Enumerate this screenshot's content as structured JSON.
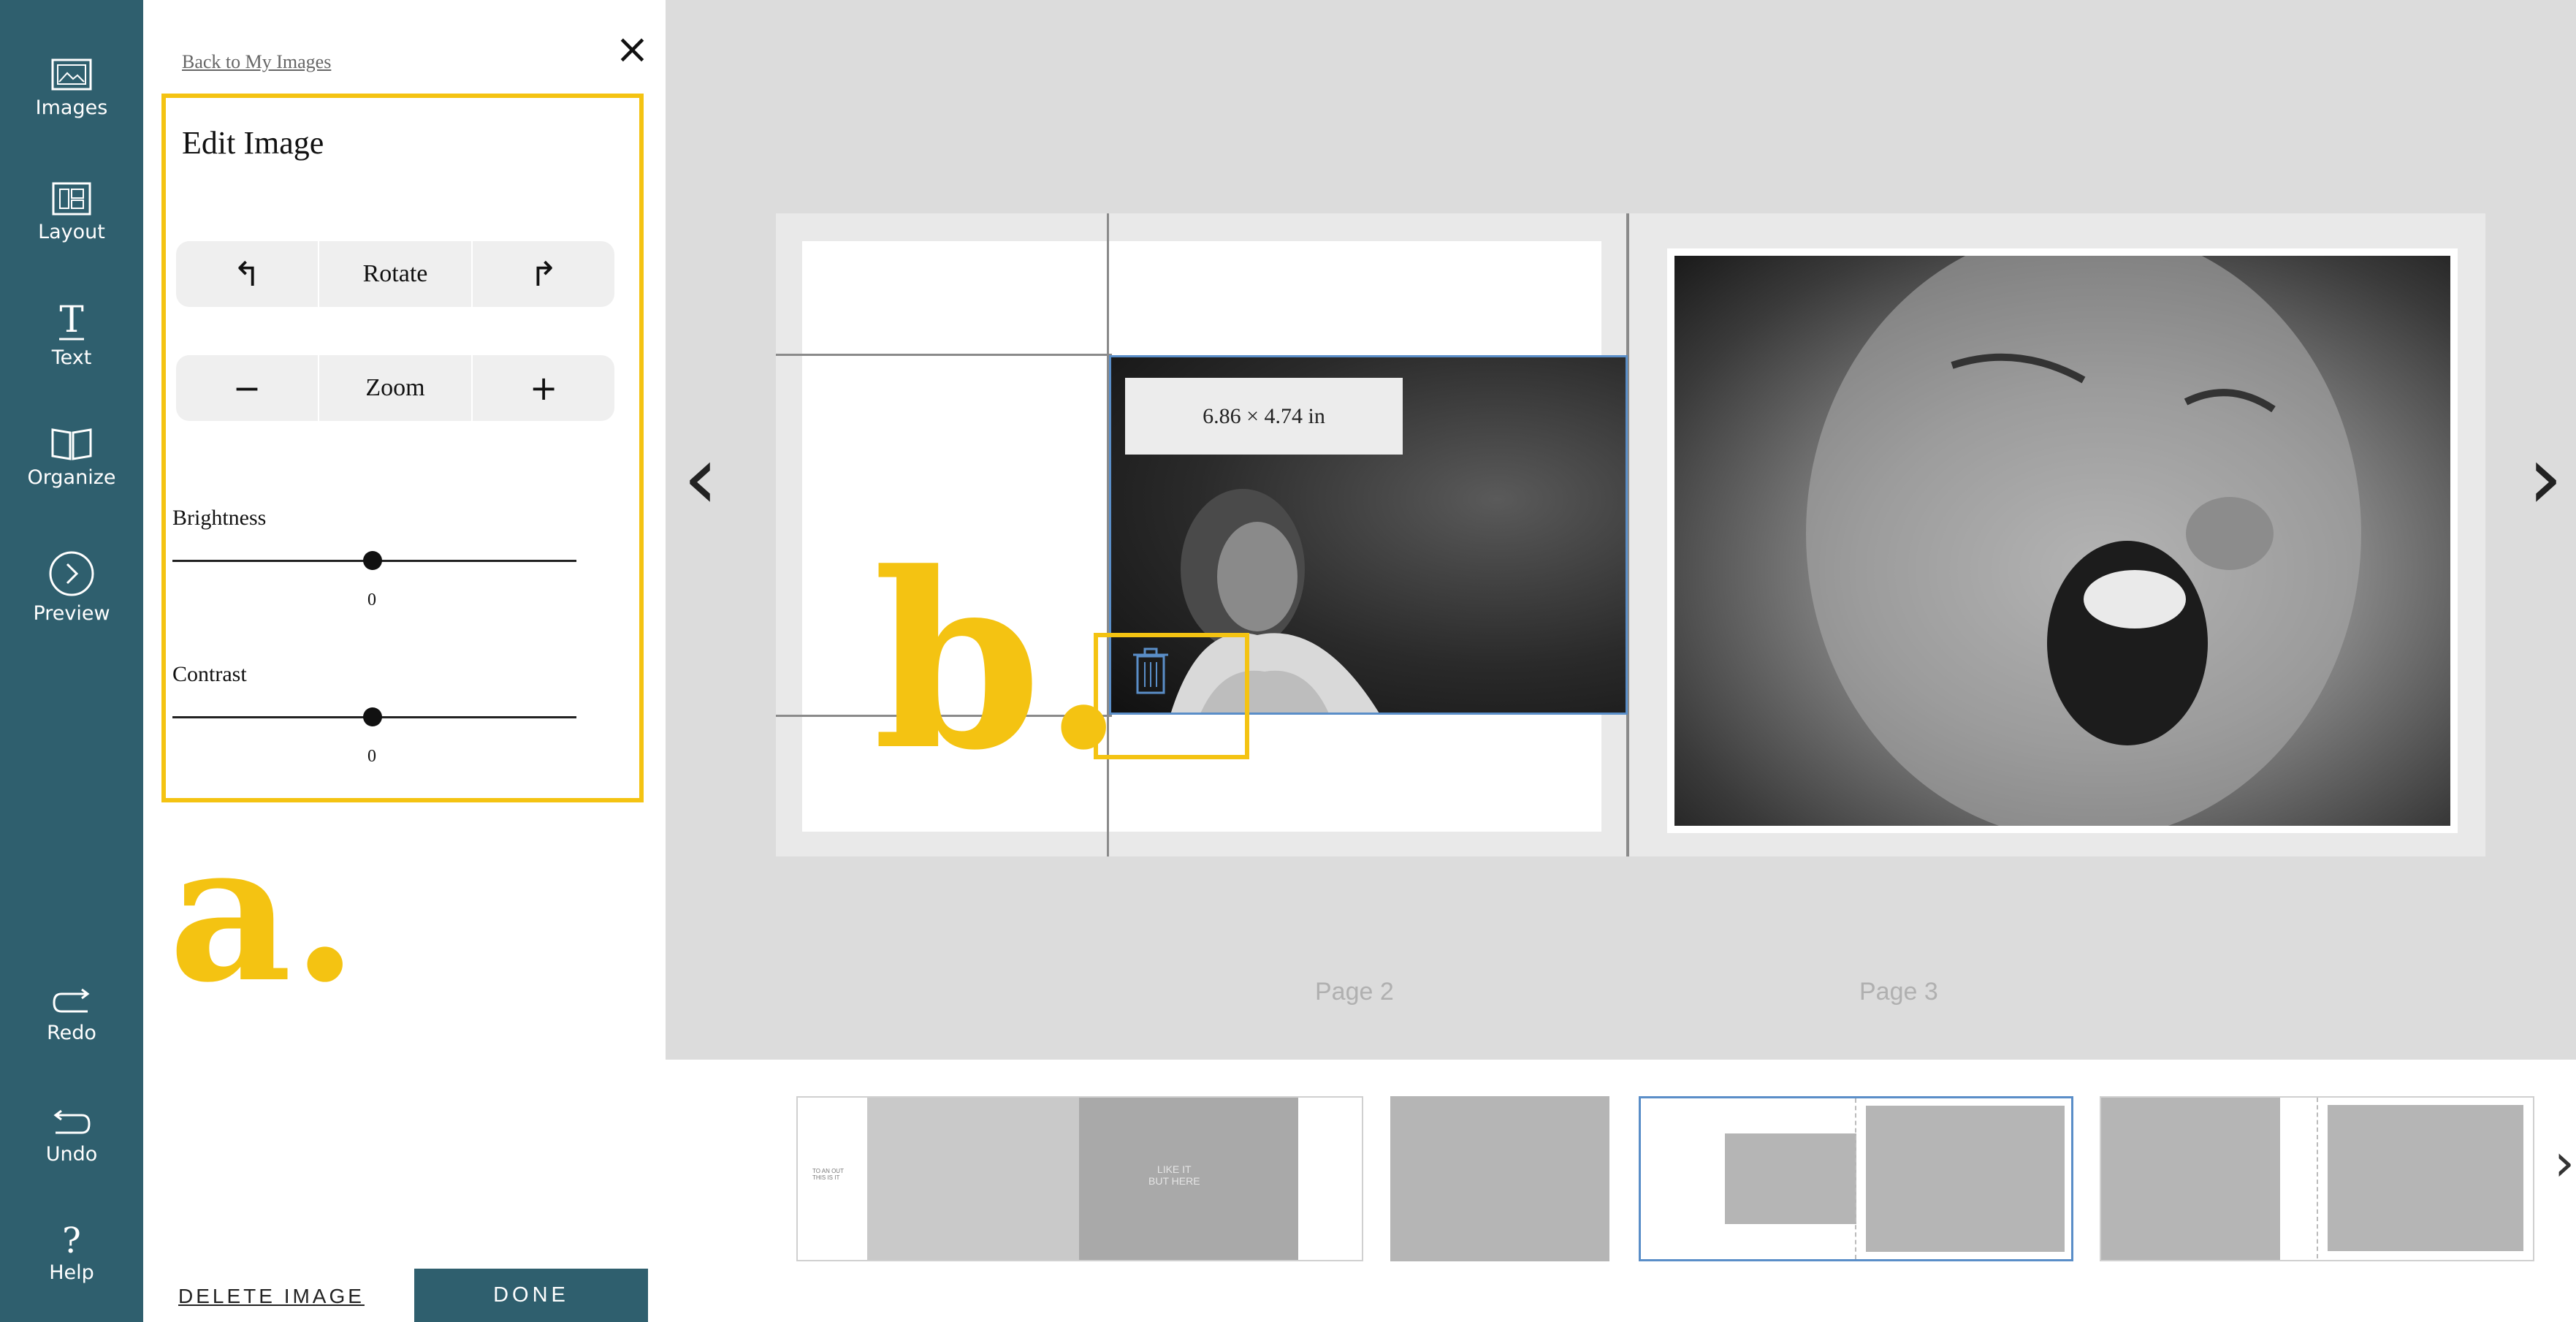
{
  "rail": {
    "items": [
      {
        "label": "Images",
        "icon": "image-icon"
      },
      {
        "label": "Layout",
        "icon": "layout-icon"
      },
      {
        "label": "Text",
        "icon": "text-icon"
      },
      {
        "label": "Organize",
        "icon": "book-icon"
      },
      {
        "label": "Preview",
        "icon": "preview-circle-icon"
      }
    ],
    "bottom": [
      {
        "label": "Redo",
        "icon": "redo-icon"
      },
      {
        "label": "Undo",
        "icon": "undo-icon"
      },
      {
        "label": "Help",
        "icon": "help-icon"
      }
    ]
  },
  "panel": {
    "back_link": "Back to My Images",
    "close_symbol": "×",
    "title": "Edit Image",
    "rotate": {
      "left": "↰",
      "label": "Rotate",
      "right": "↱"
    },
    "zoom": {
      "minus": "−",
      "label": "Zoom",
      "plus": "+"
    },
    "brightness": {
      "label": "Brightness",
      "value": "0"
    },
    "contrast": {
      "label": "Contrast",
      "value": "0"
    },
    "delete_label": "DELETE IMAGE",
    "done_label": "DONE"
  },
  "annotations": {
    "a": "a.",
    "b": "b."
  },
  "canvas": {
    "size_label": "6.86 × 4.74 in",
    "prev_arrow": "‹",
    "next_arrow": "›",
    "page_labels": [
      "Page 2",
      "Page 3"
    ]
  },
  "strip": {
    "cover_text_left": "TO AN OUT\nTHIS IS IT",
    "cover_text_center": "LIKE IT\nBUT HERE",
    "next_arrow": "›"
  },
  "colors": {
    "accent": "#f4c312",
    "rail": "#2f5f6e",
    "selection": "#5a8ec8"
  }
}
